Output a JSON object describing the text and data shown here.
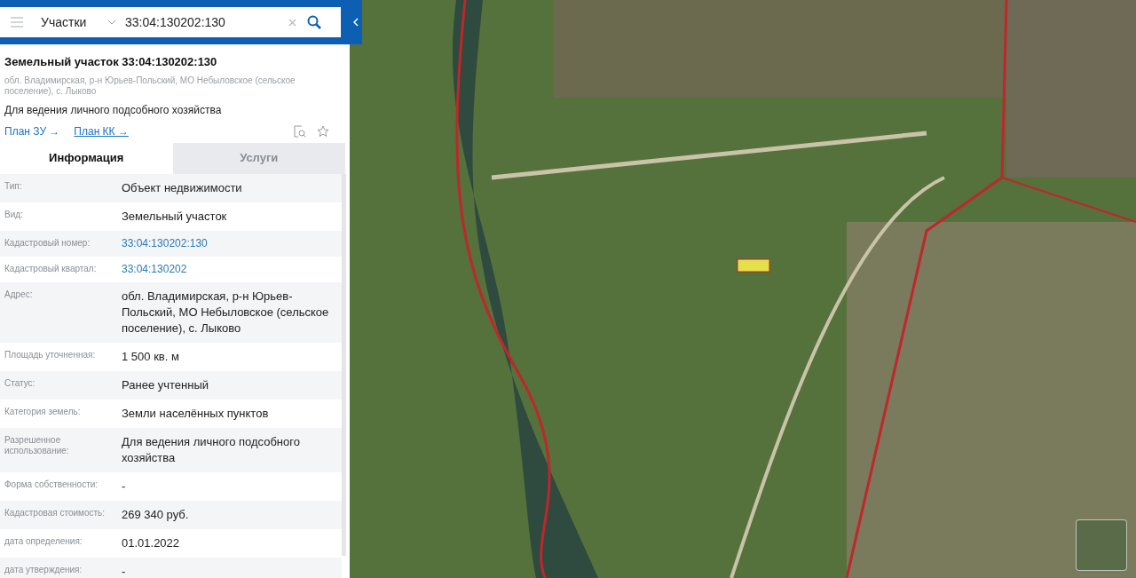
{
  "search": {
    "category": "Участки",
    "value": "33:04:130202:130"
  },
  "object": {
    "title": "Земельный участок 33:04:130202:130",
    "address": "обл. Владимирская, р-н Юрьев-Польский, МО Небыловское (сельское поселение), с. Лыково",
    "purpose": "Для ведения личного подсобного хозяйства"
  },
  "plan_links": [
    "План ЗУ →",
    "План КК →"
  ],
  "tabs": [
    {
      "label": "Информация",
      "selected": true
    },
    {
      "label": "Услуги",
      "selected": false
    }
  ],
  "rows": [
    {
      "label": "Тип:",
      "value": "Объект недвижимости",
      "kind": "text"
    },
    {
      "label": "Вид:",
      "value": "Земельный участок",
      "kind": "text"
    },
    {
      "label": "Кадастровый номер:",
      "value": "33:04:130202:130",
      "kind": "link"
    },
    {
      "label": "Кадастровый квартал:",
      "value": "33:04:130202",
      "kind": "link"
    },
    {
      "label": "Адрес:",
      "value": "обл. Владимирская, р-н Юрьев-Польский, МО Небыловское (сельское поселение), с. Лыково",
      "kind": "text"
    },
    {
      "label": "Площадь уточненная:",
      "value": "1 500 кв. м",
      "kind": "text"
    },
    {
      "label": "Статус:",
      "value": "Ранее учтенный",
      "kind": "text"
    },
    {
      "label": "Категория земель:",
      "value": "Земли населённых пунктов",
      "kind": "text"
    },
    {
      "label": "Разрешенное использование:",
      "value": "Для ведения личного подсобного хозяйства",
      "kind": "text"
    },
    {
      "label": "Форма собственности:",
      "value": "-",
      "kind": "text"
    },
    {
      "label": "Кадастровая стоимость:",
      "value": "269 340 руб.",
      "kind": "text"
    },
    {
      "label": "дата определения:",
      "value": "01.01.2022",
      "kind": "text"
    },
    {
      "label": "дата утверждения:",
      "value": "-",
      "kind": "text"
    }
  ]
}
